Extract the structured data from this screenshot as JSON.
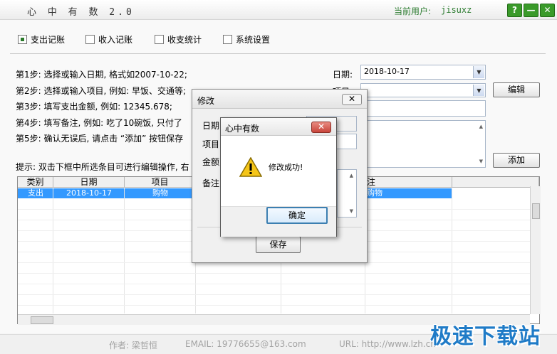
{
  "app": {
    "title": "心 中 有 数  2.0",
    "user_label": "当前用户:",
    "user_name": "jisuxz",
    "help_label": "?",
    "minimize_label": "—",
    "close_label": "✕"
  },
  "tabs": [
    {
      "label": "支出记账",
      "checked": true
    },
    {
      "label": "收入记账",
      "checked": false
    },
    {
      "label": "收支统计",
      "checked": false
    },
    {
      "label": "系统设置",
      "checked": false
    }
  ],
  "steps": [
    "第1步: 选择或输入日期, 格式如2007-10-22;",
    "第2步: 选择或输入项目, 例如: 早饭、交通等;",
    "第3步: 填写支出金额, 例如: 12345.678;",
    "第4步: 填写备注, 例如: 吃了10碗饭, 只付了",
    "第5步: 确认无误后, 请点击 “添加” 按钮保存"
  ],
  "tip": "提示: 双击下框中所选条目可进行编辑操作, 右",
  "form": {
    "date_label": "日期:",
    "date_value": "2018-10-17",
    "item_label": "项目",
    "item_value": "",
    "edit_button": "编辑",
    "add_button": "添加"
  },
  "grid": {
    "columns": [
      "类别",
      "日期",
      "项目",
      "",
      "",
      "注"
    ],
    "rows": [
      {
        "category": "支出",
        "date": "2018-10-17",
        "item": "购物",
        "note": "购物"
      }
    ]
  },
  "footer": {
    "author": "作者: 梁哲恒",
    "email": "EMAIL: 19776655@163.com",
    "url": "URL: http://www.lzh.cn"
  },
  "watermark": "极速下载站",
  "edit_dialog": {
    "title": "修改",
    "close_label": "✕",
    "labels": [
      "日期",
      "项目",
      "金额",
      "备注"
    ],
    "save_button": "保存"
  },
  "msgbox": {
    "title": "心中有数",
    "close_label": "✕",
    "message": "修改成功!",
    "ok_button": "确定"
  },
  "colors": {
    "accent_green": "#3a9a2a",
    "selection_blue": "#3399ff",
    "close_red": "#c8453b",
    "watermark_blue": "#1f7bc7"
  }
}
